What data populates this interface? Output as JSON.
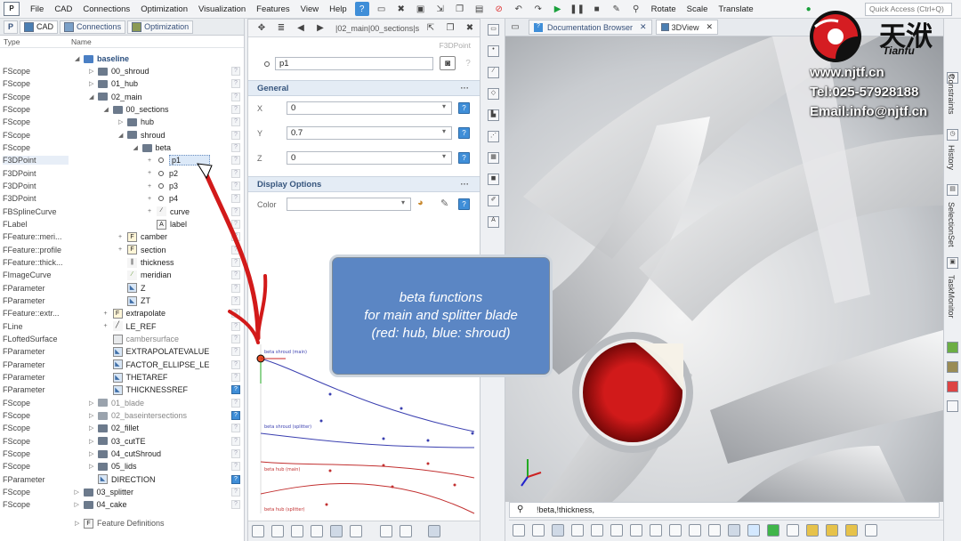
{
  "menubar": {
    "logo": "P",
    "items": [
      "File",
      "CAD",
      "Connections",
      "Optimization",
      "Visualization",
      "Features",
      "View",
      "Help"
    ],
    "actions": [
      "Rotate",
      "Scale",
      "Translate"
    ],
    "quick_access": "Quick Access (Ctrl+Q)"
  },
  "left_panel": {
    "tabs": [
      "CAD",
      "Connections",
      "Optimization"
    ],
    "columns": {
      "type": "Type",
      "name": "Name"
    },
    "root": "baseline",
    "rows": [
      {
        "type": "FScope",
        "name": "00_shroud"
      },
      {
        "type": "FScope",
        "name": "01_hub"
      },
      {
        "type": "FScope",
        "name": "02_main"
      },
      {
        "type": "FScope",
        "name": "00_sections"
      },
      {
        "type": "FScope",
        "name": "hub"
      },
      {
        "type": "FScope",
        "name": "shroud"
      },
      {
        "type": "FScope",
        "name": "beta"
      },
      {
        "type": "F3DPoint",
        "name": "p1"
      },
      {
        "type": "F3DPoint",
        "name": "p2"
      },
      {
        "type": "F3DPoint",
        "name": "p3"
      },
      {
        "type": "F3DPoint",
        "name": "p4"
      },
      {
        "type": "FBSplineCurve",
        "name": "curve"
      },
      {
        "type": "FLabel",
        "name": "label"
      },
      {
        "type": "FFeature::meri...",
        "name": "camber"
      },
      {
        "type": "FFeature::profile",
        "name": "section"
      },
      {
        "type": "FFeature::thick...",
        "name": "thickness"
      },
      {
        "type": "FImageCurve",
        "name": "meridian"
      },
      {
        "type": "FParameter",
        "name": "Z"
      },
      {
        "type": "FParameter",
        "name": "ZT"
      },
      {
        "type": "FFeature::extr...",
        "name": "extrapolate"
      },
      {
        "type": "FLine",
        "name": "LE_REF"
      },
      {
        "type": "FLoftedSurface",
        "name": "cambersurface"
      },
      {
        "type": "FParameter",
        "name": "EXTRAPOLATEVALUE"
      },
      {
        "type": "FParameter",
        "name": "FACTOR_ELLIPSE_LE"
      },
      {
        "type": "FParameter",
        "name": "THETAREF"
      },
      {
        "type": "FParameter",
        "name": "THICKNESSREF"
      },
      {
        "type": "FScope",
        "name": "01_blade"
      },
      {
        "type": "FScope",
        "name": "02_baseintersections"
      },
      {
        "type": "FScope",
        "name": "02_fillet"
      },
      {
        "type": "FScope",
        "name": "03_cutTE"
      },
      {
        "type": "FScope",
        "name": "04_cutShroud"
      },
      {
        "type": "FScope",
        "name": "05_lids"
      },
      {
        "type": "FParameter",
        "name": "DIRECTION"
      },
      {
        "type": "FScope",
        "name": "03_splitter"
      },
      {
        "type": "FScope",
        "name": "04_cake"
      }
    ],
    "footer": "Feature Definitions"
  },
  "mid_panel": {
    "breadcrumb": "|02_main|00_sections|s",
    "class_label": "F3DPoint",
    "name_value": "p1",
    "general_header": "General",
    "fields": [
      {
        "label": "X",
        "value": "0"
      },
      {
        "label": "Y",
        "value": "0.7"
      },
      {
        "label": "Z",
        "value": "0"
      }
    ],
    "display_header": "Display Options",
    "color_label": "Color",
    "plot_labels": [
      "beta shroud (main)",
      "beta shroud (splitter)",
      "beta hub (main)",
      "beta hub (splitter)"
    ]
  },
  "view_tabs": [
    "Documentation Browser",
    "3DView"
  ],
  "callout": {
    "line1": "beta functions",
    "line2": "for main and splitter blade",
    "line3": "(red: hub, blue: shroud)"
  },
  "watermark": {
    "brand_cn": "天洑",
    "brand_en": "Tianfu",
    "web": "www.njtf.cn",
    "tel": "Tel:025-57928188",
    "email": "Email:info@njtf.cn"
  },
  "command_line": "!beta,!thickness,",
  "right_strip": [
    "Constraints",
    "History",
    "SelectionSet",
    "TaskMonitor"
  ]
}
